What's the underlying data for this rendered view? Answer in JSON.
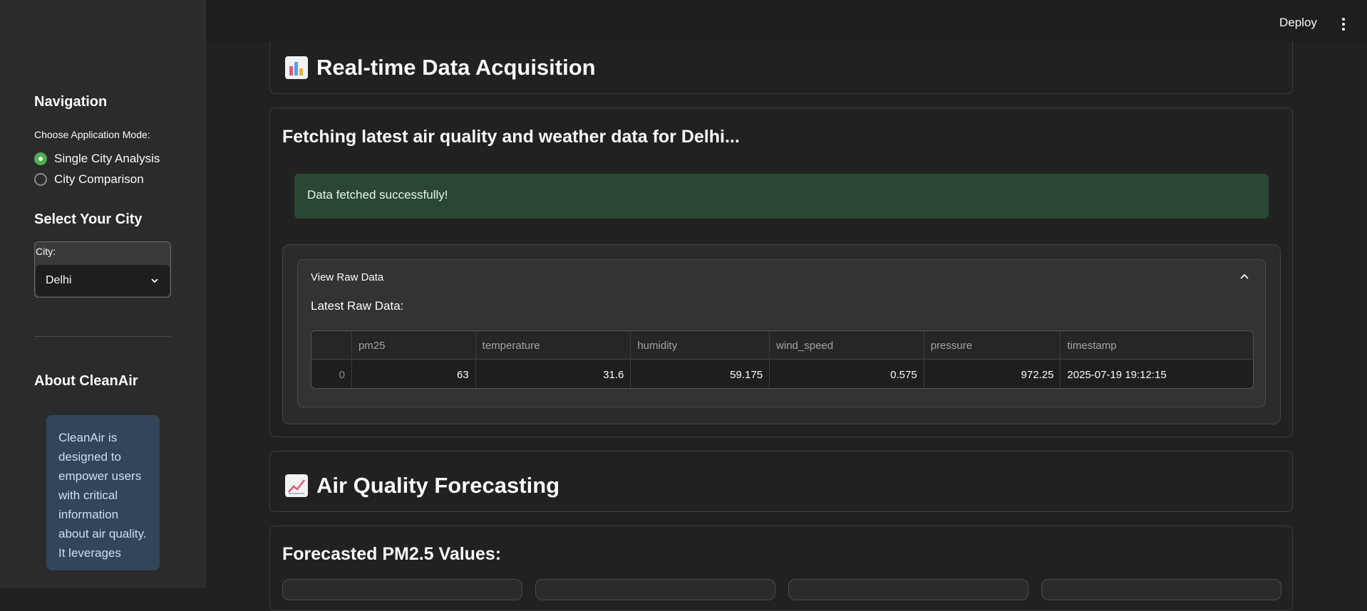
{
  "sidebar": {
    "nav_heading": "Navigation",
    "mode_label": "Choose Application Mode:",
    "modes": [
      {
        "label": "Single City Analysis",
        "selected": true
      },
      {
        "label": "City Comparison",
        "selected": false
      }
    ],
    "city_heading": "Select Your City",
    "city_label": "City:",
    "city_value": "Delhi",
    "about_heading": "About CleanAir",
    "about_text": "CleanAir is designed to empower users with critical information about air quality. It leverages"
  },
  "header": {
    "deploy_label": "Deploy"
  },
  "acquisition": {
    "icon": "bar-chart-icon",
    "title": "Real-time Data Acquisition",
    "fetching_text": "Fetching latest air quality and weather data for Delhi...",
    "success_text": "Data fetched successfully!",
    "expander_label": "View Raw Data",
    "raw_label": "Latest Raw Data:",
    "table": {
      "columns": [
        "",
        "pm25",
        "temperature",
        "humidity",
        "wind_speed",
        "pressure",
        "timestamp"
      ],
      "rows": [
        [
          "0",
          "63",
          "31.6",
          "59.175",
          "0.575",
          "972.25",
          "2025-07-19 19:12:15"
        ]
      ]
    }
  },
  "forecasting": {
    "icon": "line-chart-icon",
    "title": "Air Quality Forecasting",
    "subtitle": "Forecasted PM2.5 Values:"
  },
  "colors": {
    "success_bg": "#2a4634",
    "radio_accent": "#4caf50",
    "info_bg": "#334558"
  }
}
